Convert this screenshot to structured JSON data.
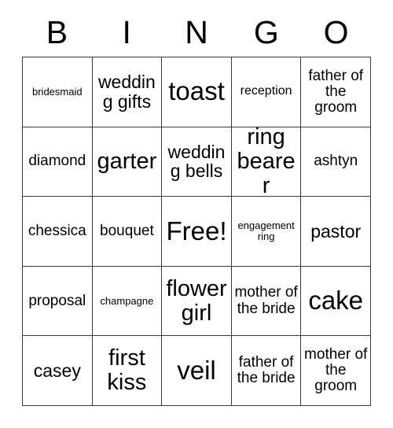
{
  "card": {
    "title_letters": [
      "B",
      "I",
      "N",
      "G",
      "O"
    ],
    "free_space": "Free!",
    "colors": {
      "background": "#ffffff",
      "text": "#000000",
      "grid_line": "#3a3a3a"
    },
    "rows": [
      [
        {
          "label": "bridesmaid",
          "size": "xs"
        },
        {
          "label": "wedding gifts",
          "size": "l"
        },
        {
          "label": "toast",
          "size": "xxl"
        },
        {
          "label": "reception",
          "size": "s"
        },
        {
          "label": "father of the groom",
          "size": "m"
        }
      ],
      [
        {
          "label": "diamond",
          "size": "m"
        },
        {
          "label": "garter",
          "size": "xl"
        },
        {
          "label": "wedding bells",
          "size": "l"
        },
        {
          "label": "ring bearer",
          "size": "xl"
        },
        {
          "label": "ashtyn",
          "size": "m"
        }
      ],
      [
        {
          "label": "chessica",
          "size": "m"
        },
        {
          "label": "bouquet",
          "size": "m"
        },
        {
          "label": "Free!",
          "size": "xxl"
        },
        {
          "label": "engagement ring",
          "size": "xs"
        },
        {
          "label": "pastor",
          "size": "l"
        }
      ],
      [
        {
          "label": "proposal",
          "size": "m"
        },
        {
          "label": "champagne",
          "size": "xs"
        },
        {
          "label": "flower girl",
          "size": "xl"
        },
        {
          "label": "mother of the bride",
          "size": "m"
        },
        {
          "label": "cake",
          "size": "xxl"
        }
      ],
      [
        {
          "label": "casey",
          "size": "l"
        },
        {
          "label": "first kiss",
          "size": "xl"
        },
        {
          "label": "veil",
          "size": "xxl"
        },
        {
          "label": "father of the bride",
          "size": "m"
        },
        {
          "label": "mother of the groom",
          "size": "m"
        }
      ]
    ]
  }
}
